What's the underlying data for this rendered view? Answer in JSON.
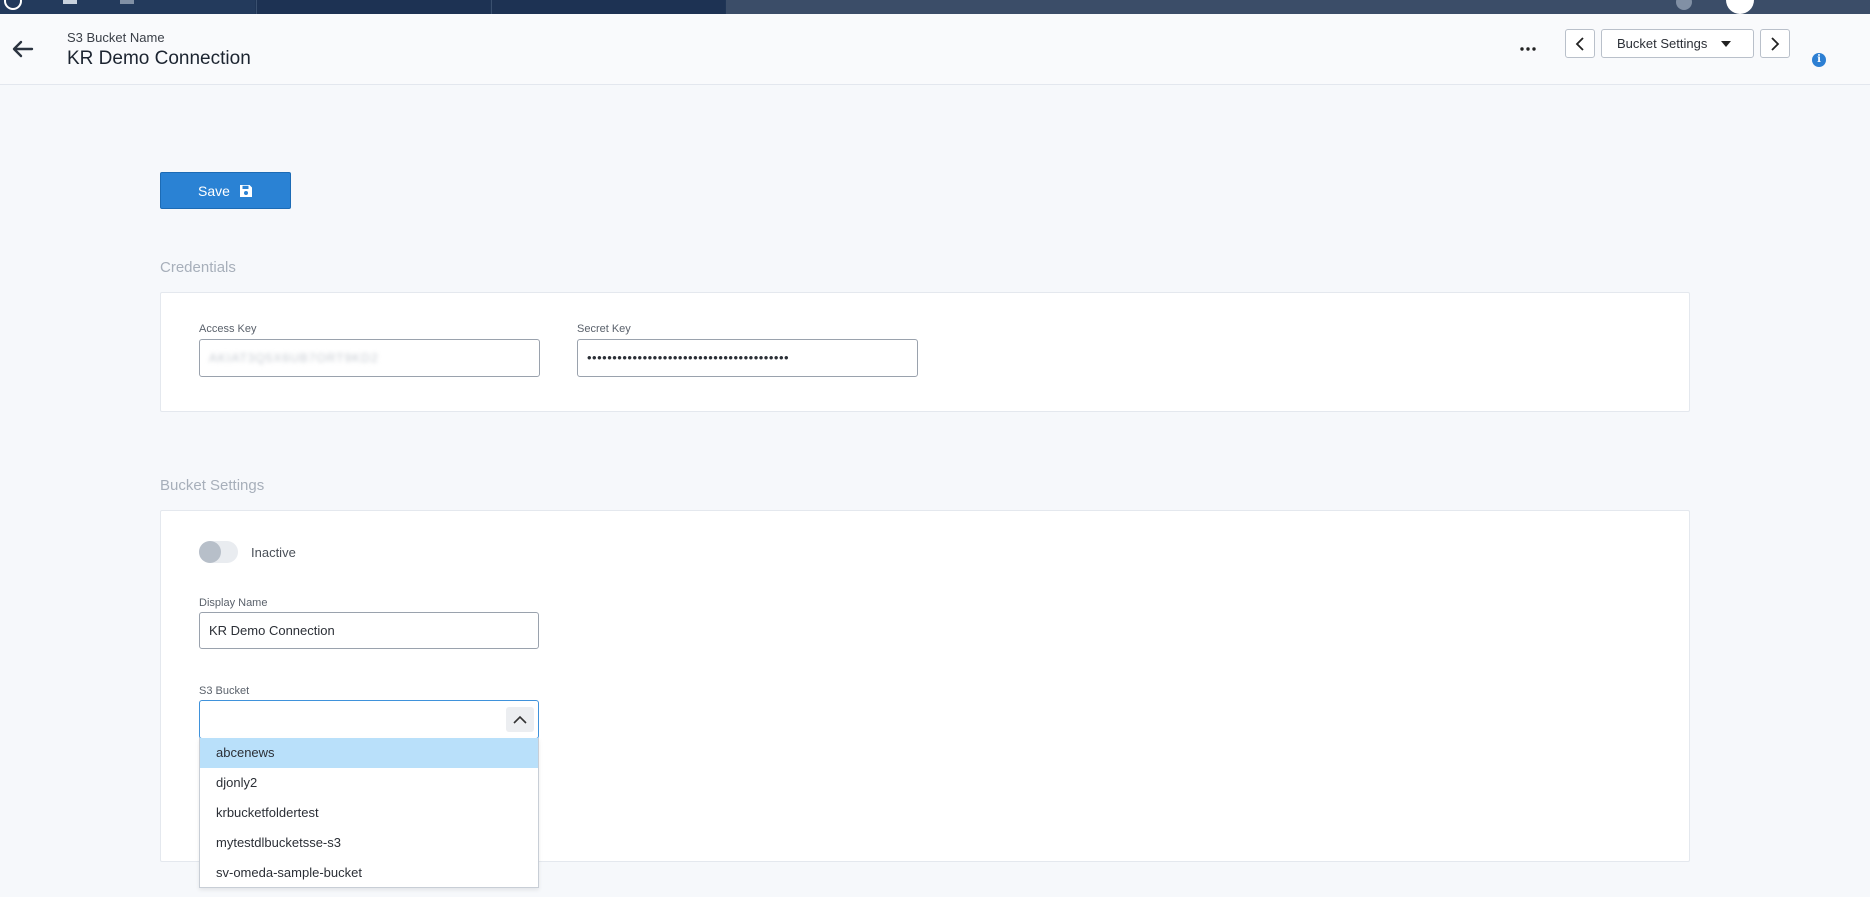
{
  "header": {
    "subtitle": "S3 Bucket Name",
    "title": "KR Demo Connection",
    "section_select": "Bucket Settings"
  },
  "toolbar": {
    "save_label": "Save"
  },
  "credentials": {
    "heading": "Credentials",
    "access_key_label": "Access Key",
    "access_key_value": "AKIAT3Q5X6UB7ORT9KD2",
    "secret_key_label": "Secret Key",
    "secret_key_value": "••••••••••••••••••••••••••••••••••••••••"
  },
  "bucket_settings": {
    "heading": "Bucket Settings",
    "toggle_label": "Inactive",
    "toggle_on": false,
    "display_name_label": "Display Name",
    "display_name_value": "KR Demo Connection",
    "s3_bucket_label": "S3 Bucket",
    "s3_bucket_value": "",
    "options": [
      "abcenews",
      "djonly2",
      "krbucketfoldertest",
      "mytestdlbucketsse-s3",
      "sv-omeda-sample-bucket"
    ],
    "highlighted_option": "abcenews"
  },
  "icons": {
    "back": "arrow-left-icon",
    "more": "more-horizontal-icon",
    "prev": "chevron-left-icon",
    "next": "chevron-right-icon",
    "dropdown_caret": "caret-down-icon",
    "info": "info-icon",
    "save": "floppy-disk-icon",
    "select_toggle": "chevron-up-icon"
  },
  "colors": {
    "accent": "#2a82d4",
    "highlight": "#b9e0fa",
    "nav_dark": "#1f3556"
  }
}
